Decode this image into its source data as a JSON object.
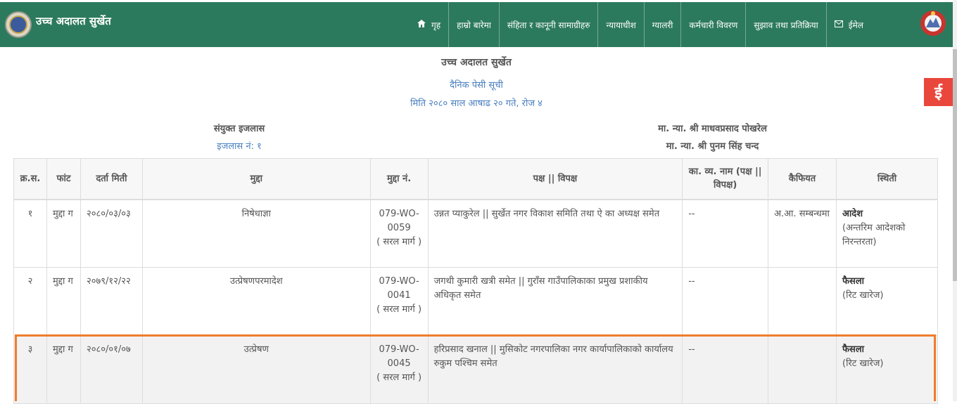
{
  "header": {
    "brand": "उच्च अदालत सुर्खेत",
    "nav": [
      {
        "icon": "home-icon",
        "label": "गृह"
      },
      {
        "label": "हाम्रो बारेमा"
      },
      {
        "label": "संहिता र कानूनी सामाग्रीहरु"
      },
      {
        "label": "न्यायाधीश"
      },
      {
        "label": "ग्यालरी"
      },
      {
        "label": "कर्मचारी विवरण"
      },
      {
        "label": "सुझाव तथा प्रतिक्रिया"
      },
      {
        "icon": "mail-icon",
        "label": "ईमेल"
      }
    ]
  },
  "side_badge": "ई",
  "court_title": "उच्च अदालत सुर्खेत",
  "list_title": "दैनिक पेसी सूची",
  "date_line": "मिति २०८० साल आषाढ २० गते, रोज ४",
  "bench": {
    "title": "संयुक्त इजलास",
    "number": "इजलास नं: १"
  },
  "judges": [
    "मा. न्या. श्री माधवप्रसाद पोखरेल",
    "मा. न्या. श्री पुनम सिंह चन्द"
  ],
  "table": {
    "headers": [
      "क्र.स.",
      "फांट",
      "दर्ता मिती",
      "मुद्दा",
      "मुद्दा नं.",
      "पक्ष || विपक्ष",
      "का. व्य. नाम (पक्ष || विपक्ष)",
      "कैफियत",
      "स्थिती"
    ],
    "rows": [
      {
        "sn": "१",
        "fant": "मुद्दा ग",
        "date": "२०८०/०३/०३",
        "case": "निषेधाज्ञा",
        "case_no": "079-WO-0059",
        "case_type": "( सरल मार्ग )",
        "parties": "उन्नत प्याकुरेल || सुर्खेत नगर विकाश समिति तथा ऐ का अध्यक्ष समेत",
        "lawyer": "--",
        "remarks": "अ.आ. सम्बन्धमा",
        "status": "आदेश",
        "status_detail": "(अन्तरिम आदेशको निरन्तरता)"
      },
      {
        "sn": "२",
        "fant": "मुद्दा ग",
        "date": "२०७९/१२/२२",
        "case": "उत्प्रेषणपरमादेश",
        "case_no": "079-WO-0041",
        "case_type": "( सरल मार्ग )",
        "parties": "जगथी कुमारी खत्री समेत || गुराँस गाउँपालिकाका प्रमुख प्रशाकीय अधिकृत समेत",
        "lawyer": "--",
        "remarks": "",
        "status": "फैसला",
        "status_detail": "(रिट खारेज)"
      },
      {
        "sn": "३",
        "fant": "मुद्दा ग",
        "date": "२०८०/०१/०७",
        "case": "उत्प्रेषण",
        "case_no": "079-WO-0045",
        "case_type": "( सरल मार्ग )",
        "parties": "हरिप्रसाद खनाल || मुसिकोट नगरपालिका नगर कार्यापालिकाको कार्यालय रुकुम पश्चिम समेत",
        "lawyer": "--",
        "remarks": "",
        "status": "फैसला",
        "status_detail": "(रिट खारेज)"
      }
    ]
  },
  "colors": {
    "navbar": "#2c7a5e",
    "link_blue": "#4a7fbf",
    "highlight": "#f07c2b",
    "badge": "#e9473c"
  }
}
